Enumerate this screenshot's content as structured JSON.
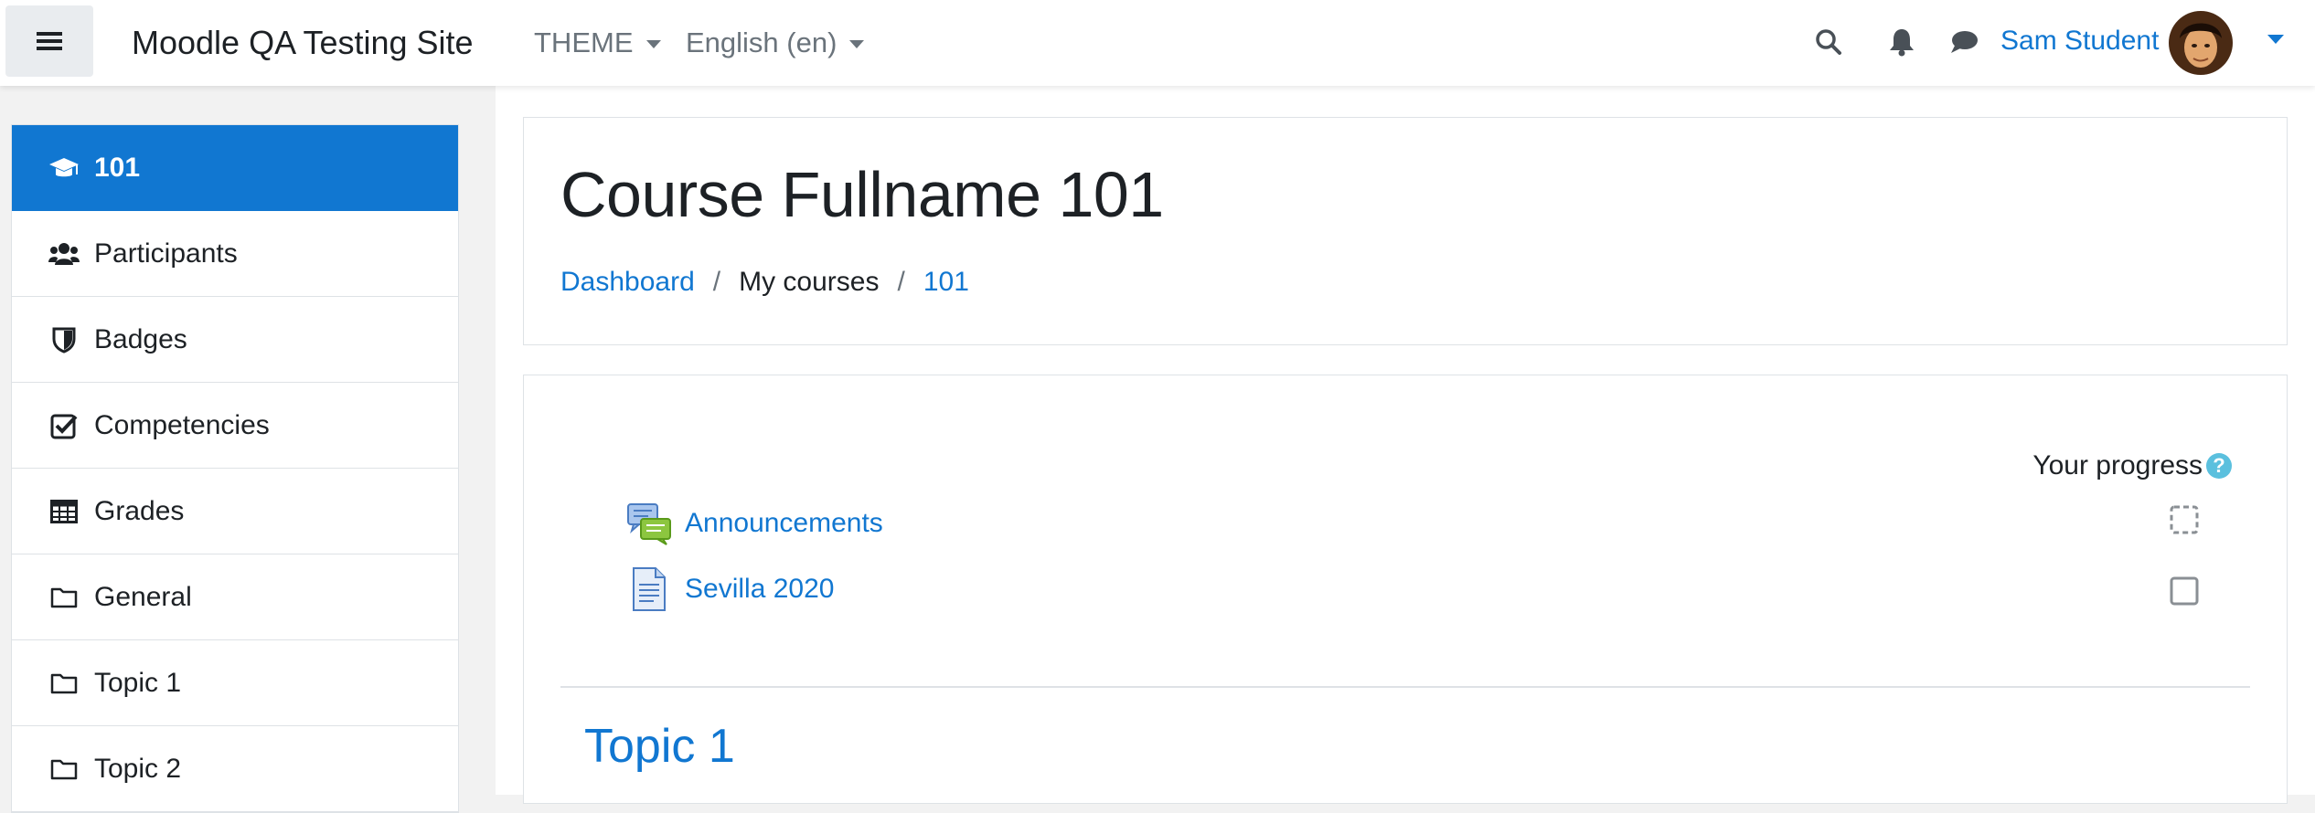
{
  "navbar": {
    "site_name": "Moodle QA Testing Site",
    "theme_menu": "THEME",
    "language_menu": "English (en)",
    "user_name": "Sam Student",
    "icons": [
      "bars-icon",
      "search-icon",
      "bell-icon",
      "comment-icon"
    ]
  },
  "drawer": {
    "items": [
      {
        "label": "101",
        "icon": "graduation-cap-icon",
        "active": true
      },
      {
        "label": "Participants",
        "icon": "users-icon"
      },
      {
        "label": "Badges",
        "icon": "shield-icon"
      },
      {
        "label": "Competencies",
        "icon": "check-square-icon"
      },
      {
        "label": "Grades",
        "icon": "table-icon"
      },
      {
        "label": "General",
        "icon": "folder-icon"
      },
      {
        "label": "Topic 1",
        "icon": "folder-icon"
      },
      {
        "label": "Topic 2",
        "icon": "folder-icon"
      }
    ]
  },
  "header": {
    "title": "Course Fullname 101",
    "breadcrumb": [
      "Dashboard",
      "My courses",
      "101"
    ]
  },
  "content": {
    "progress_label": "Your progress",
    "help_glyph": "?",
    "activities": [
      {
        "name": "Announcements",
        "icon": "forum-icon",
        "completion": "automatic"
      },
      {
        "name": "Sevilla 2020",
        "icon": "page-icon",
        "completion": "manual"
      }
    ],
    "section_title": "Topic 1"
  },
  "colors": {
    "accent": "#1177d1",
    "text": "#1d2125",
    "muted": "#6a737b",
    "border": "#dee2e6",
    "help": "#5bc0de"
  }
}
